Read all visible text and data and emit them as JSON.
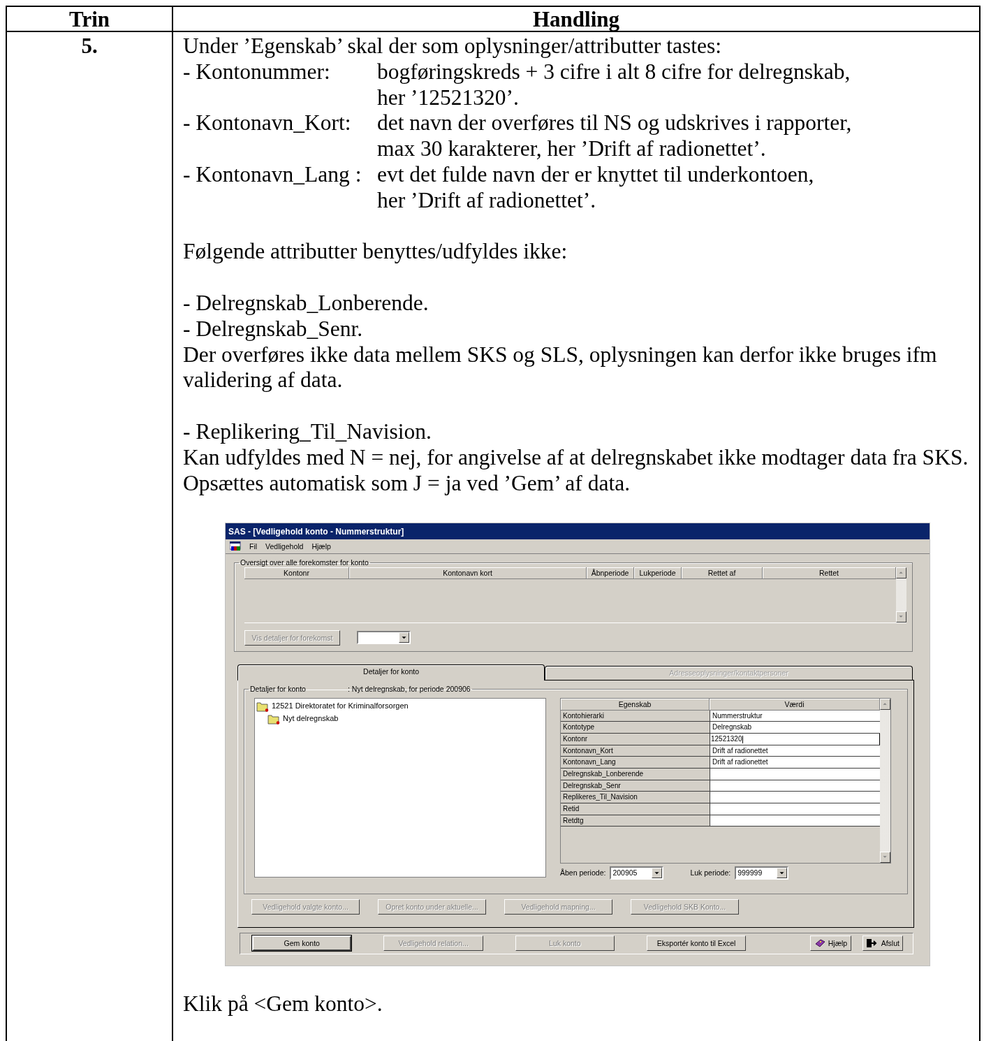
{
  "table": {
    "columns": [
      "Trin",
      "Handling"
    ],
    "step": "5.",
    "content": [
      {
        "kind": "text",
        "text": "Under ’Egenskab’ skal der som oplysninger/attributter tastes:"
      },
      {
        "kind": "definition",
        "label": "- Kontonummer:",
        "lines": [
          "bogføringskreds + 3 cifre i alt 8 cifre for delregnskab,",
          "her ’12521320’."
        ]
      },
      {
        "kind": "definition",
        "label": "- Kontonavn_Kort:",
        "lines": [
          "det navn der overføres til NS og udskrives i rapporter,",
          "max 30 karakterer, her ’Drift af radionettet’."
        ]
      },
      {
        "kind": "definition",
        "label": "- Kontonavn_Lang :",
        "lines": [
          "evt det fulde navn der er knyttet til underkontoen,",
          "her ’Drift af radionettet’."
        ]
      },
      {
        "kind": "blank"
      },
      {
        "kind": "text",
        "text": "Følgende attributter benyttes/udfyldes ikke:"
      },
      {
        "kind": "blank"
      },
      {
        "kind": "text",
        "text": "- Delregnskab_Lonberende."
      },
      {
        "kind": "text",
        "text": "- Delregnskab_Senr."
      },
      {
        "kind": "text",
        "text": "Der overføres ikke data mellem SKS og SLS, oplysningen kan derfor ikke bruges ifm validering af data."
      },
      {
        "kind": "blank"
      },
      {
        "kind": "text",
        "text": "- Replikering_Til_Navision."
      },
      {
        "kind": "text",
        "text": "Kan udfyldes med N = nej, for angivelse af at delregnskabet ikke modtager data fra SKS."
      },
      {
        "kind": "text",
        "text": "Opsættes automatisk som J = ja ved ’Gem’ af data."
      },
      {
        "kind": "screenshot"
      },
      {
        "kind": "text",
        "text": "Klik på <Gem konto>."
      }
    ]
  },
  "app_window": {
    "title": "SAS - [Vedligehold konto - Nummerstruktur]",
    "menu": [
      "Fil",
      "Vedligehold",
      "Hjælp"
    ],
    "overview": {
      "legend": "Oversigt over alle forekomster for konto",
      "columns": [
        "Kontonr",
        "Kontonavn kort",
        "Åbnperiode",
        "Lukperiode",
        "Rettet af",
        "Rettet"
      ],
      "detail_button": {
        "label": "Vis detaljer for forekomst",
        "disabled": true
      }
    },
    "tabs": [
      {
        "label": "Detaljer for konto",
        "selected": true,
        "disabled": false
      },
      {
        "label": "Adresseoplysninger/kontaktpersoner",
        "selected": false,
        "disabled": true
      }
    ],
    "details": {
      "legend": "Detaljer for konto",
      "subtitle": ": Nyt delregnskab, for periode 200906",
      "tree": [
        {
          "label": "12521 Direktoratet for Kriminalforsorgen",
          "children": [
            {
              "label": "Nyt delregnskab"
            }
          ]
        }
      ],
      "grid": {
        "columns": [
          "Egenskab",
          "Værdi"
        ],
        "rows": [
          {
            "property": "Kontohierarki",
            "value": "Nummerstruktur",
            "editing": false
          },
          {
            "property": "Kontotype",
            "value": "Delregnskab",
            "editing": false
          },
          {
            "property": "Kontonr",
            "value": "12521320",
            "editing": true
          },
          {
            "property": "Kontonavn_Kort",
            "value": "Drift af radionettet",
            "editing": false
          },
          {
            "property": "Kontonavn_Lang",
            "value": "Drift af radionettet",
            "editing": false
          },
          {
            "property": "Delregnskab_Lonberende",
            "editing": false
          },
          {
            "property": "Delregnskab_Senr",
            "editing": false
          },
          {
            "property": "Replikeres_Til_Navision",
            "editing": false
          },
          {
            "property": "Retid",
            "editing": false
          },
          {
            "property": "Retdtg",
            "editing": false
          }
        ]
      },
      "open_period": {
        "label": "Åben periode:",
        "value": "200905"
      },
      "close_period": {
        "label": "Luk periode:",
        "value": "999999"
      },
      "buttons": [
        {
          "label": "Vedligehold valgte konto...",
          "disabled": true
        },
        {
          "label": "Opret konto under aktuelle...",
          "disabled": true
        },
        {
          "label": "Vedligehold mapning...",
          "disabled": true
        },
        {
          "label": "Vedligehold SKB Konto...",
          "disabled": true
        }
      ]
    },
    "footer_buttons": [
      {
        "kind": "default",
        "label": "Gem konto",
        "disabled": false
      },
      {
        "kind": "plain",
        "label": "Vedligehold relation...",
        "disabled": true
      },
      {
        "kind": "plain",
        "label": "Luk konto",
        "disabled": true
      },
      {
        "kind": "plain",
        "label": "Eksportér konto til Excel",
        "disabled": false
      },
      {
        "kind": "help",
        "label": "Hjælp",
        "disabled": false
      },
      {
        "kind": "exit",
        "label": "Afslut",
        "disabled": false
      }
    ]
  }
}
